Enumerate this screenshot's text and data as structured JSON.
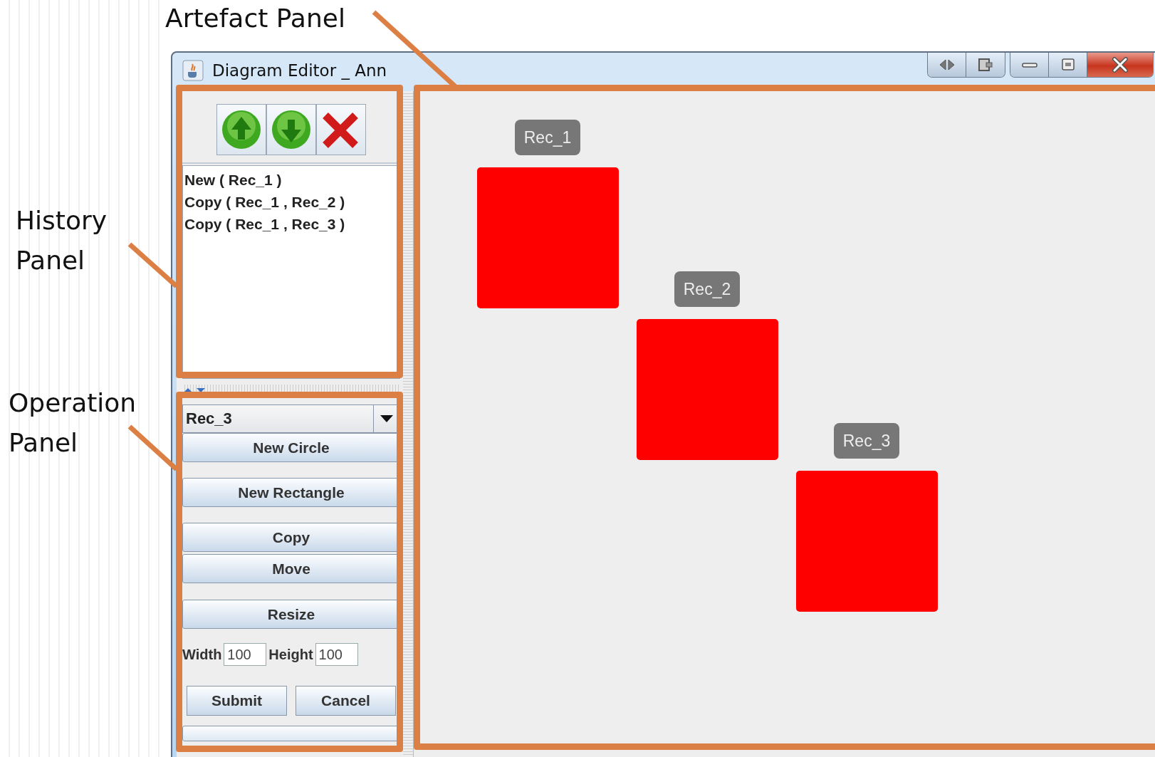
{
  "annotations": [
    {
      "text": "Artefact Panel"
    },
    {
      "text": "History Panel"
    },
    {
      "text": "Operation Panel"
    }
  ],
  "window": {
    "title": "Diagram Editor _ Ann"
  },
  "history": {
    "entries": [
      "New ( Rec_1 )",
      "Copy ( Rec_1 , Rec_2 )",
      "Copy ( Rec_1 , Rec_3 )"
    ]
  },
  "operation": {
    "selected_shape": "Rec_3",
    "buttons": [
      "New Circle",
      "New Rectangle",
      "Copy",
      "Move",
      "Resize"
    ],
    "width_label": "Width",
    "width_value": "100",
    "height_label": "Height",
    "height_value": "100",
    "actions": [
      "Submit",
      "Cancel"
    ]
  },
  "canvas": {
    "shapes": [
      {
        "kind": "rectangle",
        "label": "Rec_1"
      },
      {
        "kind": "rectangle",
        "label": "Rec_2"
      },
      {
        "kind": "rectangle",
        "label": "Rec_3"
      }
    ]
  }
}
